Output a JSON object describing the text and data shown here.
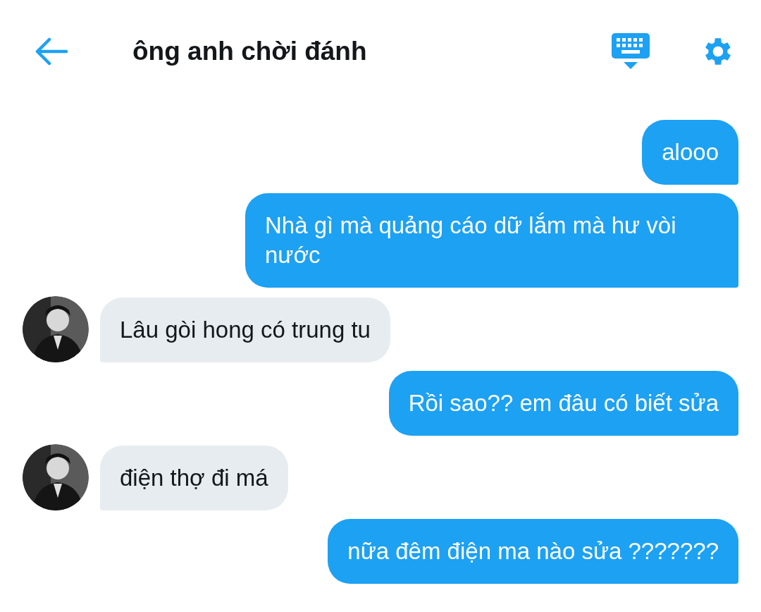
{
  "header": {
    "title": "ông anh chời đánh"
  },
  "messages": [
    {
      "kind": "sent",
      "text": "alooo"
    },
    {
      "kind": "sent",
      "text": "Nhà gì mà quảng cáo dữ lắm mà hư vòi nước"
    },
    {
      "kind": "received",
      "text": "Lâu gòi hong có trung tu"
    },
    {
      "kind": "sent",
      "text": "Rồi sao?? em đâu có biết sửa"
    },
    {
      "kind": "received",
      "text": "điện thợ đi má"
    },
    {
      "kind": "sent",
      "text": "nữa đêm điện ma nào sửa ???????"
    }
  ]
}
